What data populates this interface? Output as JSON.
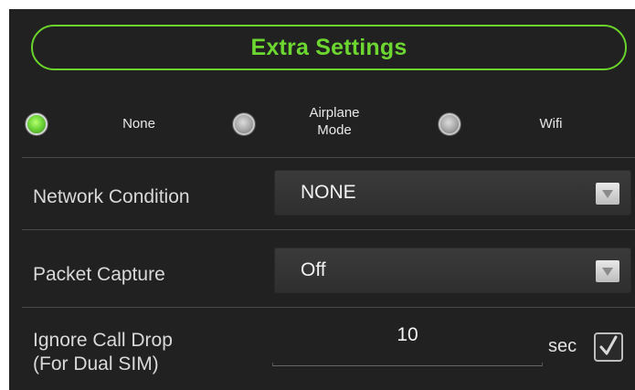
{
  "header": {
    "title": "Extra Settings"
  },
  "mode": {
    "options": [
      {
        "label": "None",
        "selected": true
      },
      {
        "label_line1": "Airplane",
        "label_line2": "Mode",
        "selected": false
      },
      {
        "label": "Wifi",
        "selected": false
      }
    ]
  },
  "network_condition": {
    "label": "Network Condition",
    "value": "NONE"
  },
  "packet_capture": {
    "label": "Packet Capture",
    "value": "Off"
  },
  "ignore_call_drop": {
    "label_line1": "Ignore Call Drop",
    "label_line2": "(For Dual SIM)",
    "value": "10",
    "unit": "sec",
    "checked": true
  },
  "colors": {
    "accent": "#6dd630",
    "panel_bg": "#212121",
    "text": "#d9d9d9"
  },
  "icons": {
    "dropdown": "dropdown-arrow-icon",
    "check": "check-icon"
  }
}
